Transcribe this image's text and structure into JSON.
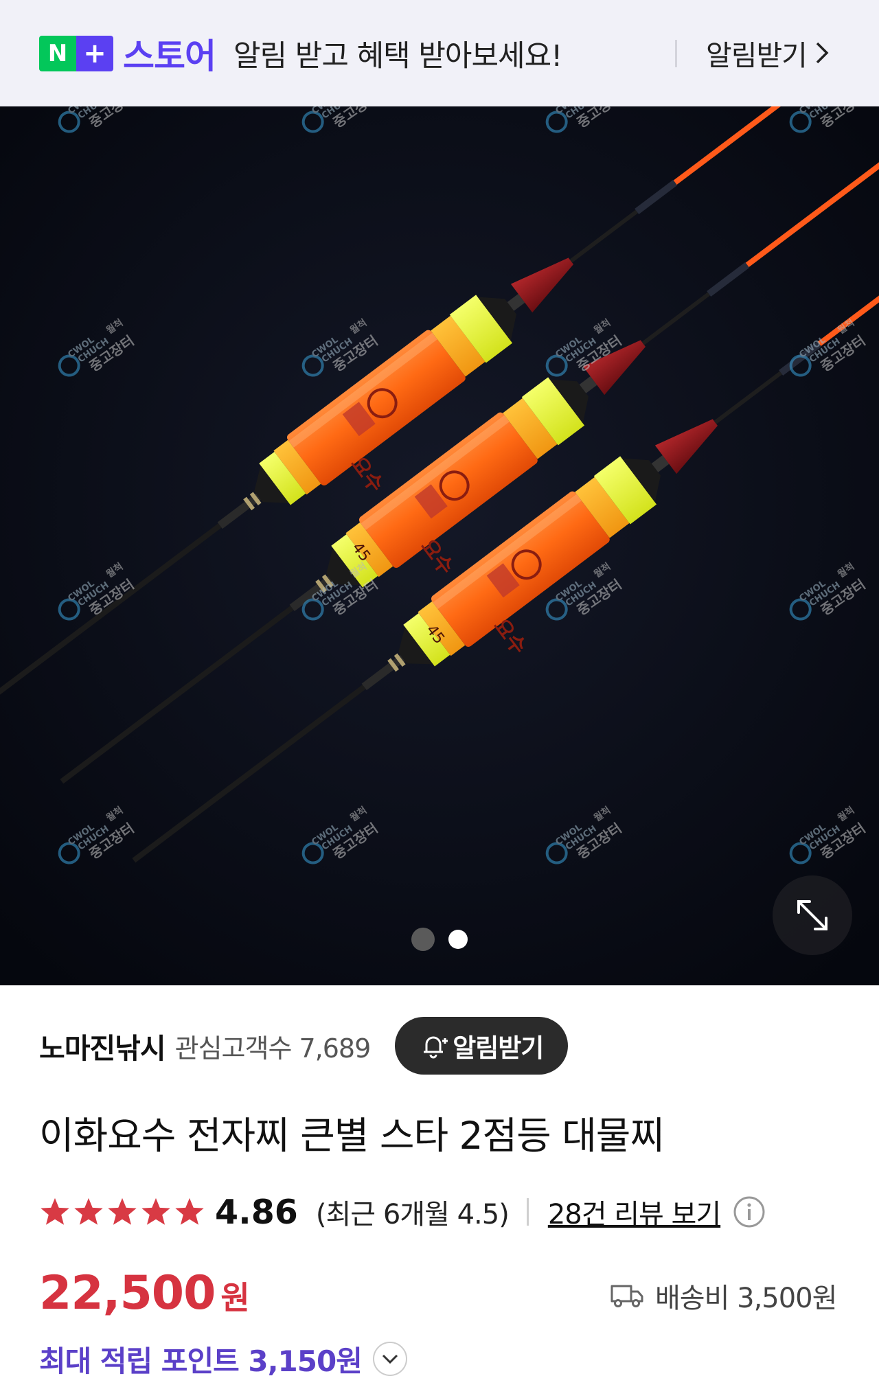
{
  "banner": {
    "logo_n": "N",
    "logo_plus": "+",
    "store_name": "스토어",
    "message": "알림 받고 혜택 받아보세요!",
    "cta_label": "알림받기"
  },
  "gallery": {
    "image_count": 2,
    "active_index": 2,
    "float_marks": [
      "요수",
      "요수",
      "요수"
    ],
    "float_numbers": [
      "45",
      "45"
    ],
    "watermark_lines": [
      "CWOL",
      "CHUCH",
      "월척",
      "중고장터"
    ]
  },
  "seller": {
    "name": "노마진낚시",
    "followers_label": "관심고객수 7,689",
    "alarm_label": "알림받기"
  },
  "product": {
    "title": "이화요수 전자찌 큰별 스타 2점등 대물찌",
    "rating": {
      "stars": 5,
      "value": "4.86",
      "recent": "(최근 6개월 4.5)",
      "review_link": "28건 리뷰 보기"
    },
    "price": "22,500",
    "price_unit": "원",
    "shipping": "배송비 3,500원",
    "points": "최대 적립 포인트 3,150원"
  },
  "colors": {
    "naver_green": "#03c75a",
    "store_purple": "#5b40f2",
    "price_red": "#d63340",
    "star_red": "#d83a44",
    "points_purple": "#5b40c8"
  }
}
